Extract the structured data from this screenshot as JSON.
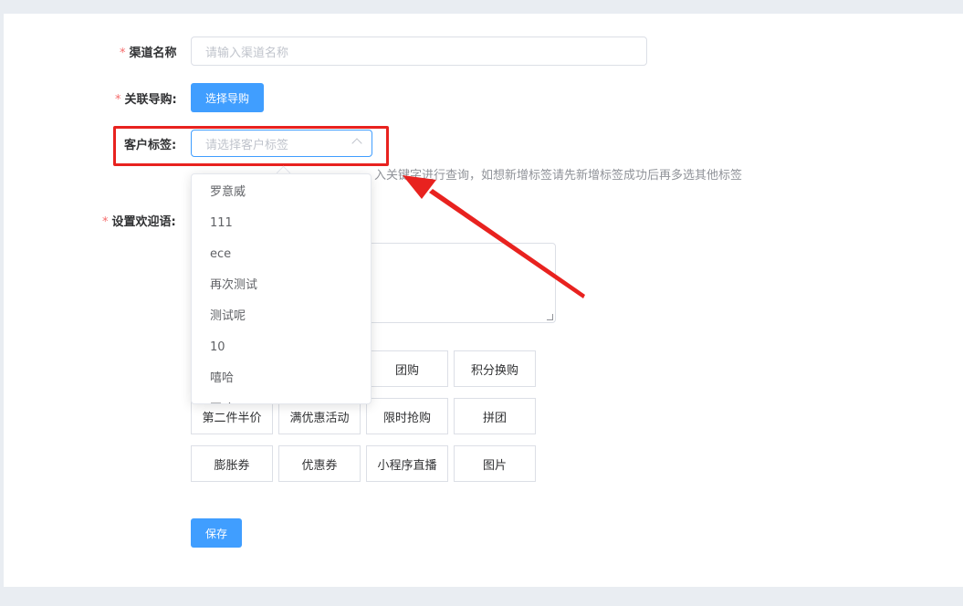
{
  "form": {
    "channel_name": {
      "required": "*",
      "label": "渠道名称",
      "placeholder": "请输入渠道名称"
    },
    "guide": {
      "required": "*",
      "label": "关联导购:",
      "button": "选择导购"
    },
    "customer_tag": {
      "label": "客户标签:",
      "placeholder": "请选择客户标签",
      "hint": "入关键字进行查询，如想新增标签请先新增标签成功后再多选其他标签",
      "options": [
        "罗意威",
        "111",
        "ece",
        "再次测试",
        "测试呢",
        "10",
        "嘻哈",
        "哥哈"
      ]
    },
    "welcome": {
      "required": "*",
      "label": "设置欢迎语:"
    },
    "tools": [
      "团购",
      "积分换购",
      "第二件半价",
      "满优惠活动",
      "限时抢购",
      "拼团",
      "膨胀券",
      "优惠券",
      "小程序直播",
      "图片"
    ],
    "save_label": "保存"
  },
  "colors": {
    "primary": "#409eff",
    "annotation": "#e8221f",
    "required": "#f56c6c"
  },
  "icons": {
    "select_chevron": "chevron-up-icon",
    "annotation_arrow": "red-arrow-icon"
  }
}
